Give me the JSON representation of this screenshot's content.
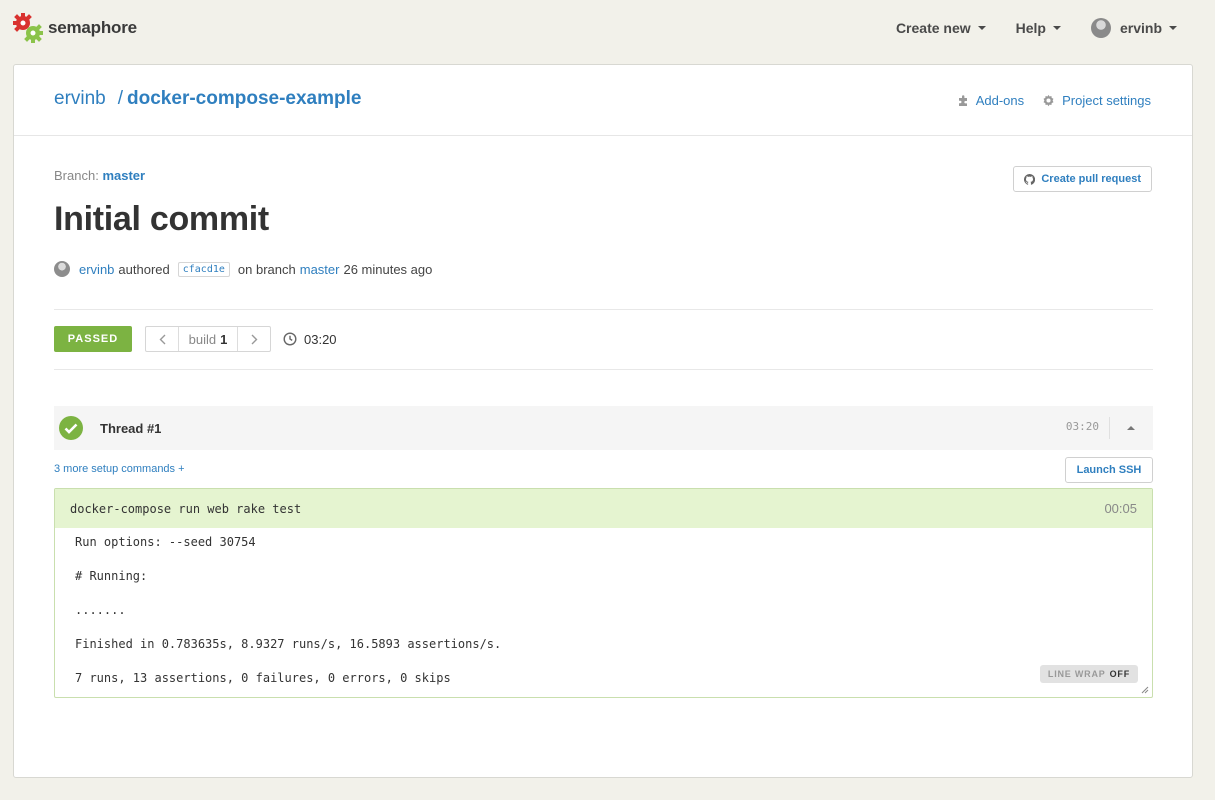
{
  "brand": {
    "name": "semaphore"
  },
  "topnav": {
    "create_new": "Create new",
    "help": "Help",
    "user": "ervinb"
  },
  "breadcrumb": {
    "owner": "ervinb",
    "separator": "/",
    "project": "docker-compose-example"
  },
  "header_links": {
    "addons": "Add-ons",
    "settings": "Project settings"
  },
  "commit": {
    "branch_label": "Branch:",
    "branch": "master",
    "pull_request_button": "Create pull request",
    "title": "Initial commit",
    "author": "ervinb",
    "authored": "authored",
    "sha": "cfacd1e",
    "on_branch": "on branch",
    "branch_link": "master",
    "time_ago": "26 minutes ago"
  },
  "build": {
    "status": "PASSED",
    "label": "build",
    "number": "1",
    "duration": "03:20"
  },
  "thread": {
    "title": "Thread #1",
    "time": "03:20",
    "setup_link": "3 more setup commands +",
    "ssh_button": "Launch SSH"
  },
  "console": {
    "command": "docker-compose run web rake test",
    "command_time": "00:05",
    "lines": [
      "Run options: --seed 30754",
      "# Running:",
      ".......",
      "Finished in 0.783635s, 8.9327 runs/s, 16.5893 assertions/s.",
      "7 runs, 13 assertions, 0 failures, 0 errors, 0 skips"
    ],
    "line_wrap_label": "LINE WRAP",
    "line_wrap_state": "OFF"
  },
  "colors": {
    "accent": "#2f7fbf",
    "passed": "#7cb342",
    "command_bg": "#e5f4d0"
  }
}
